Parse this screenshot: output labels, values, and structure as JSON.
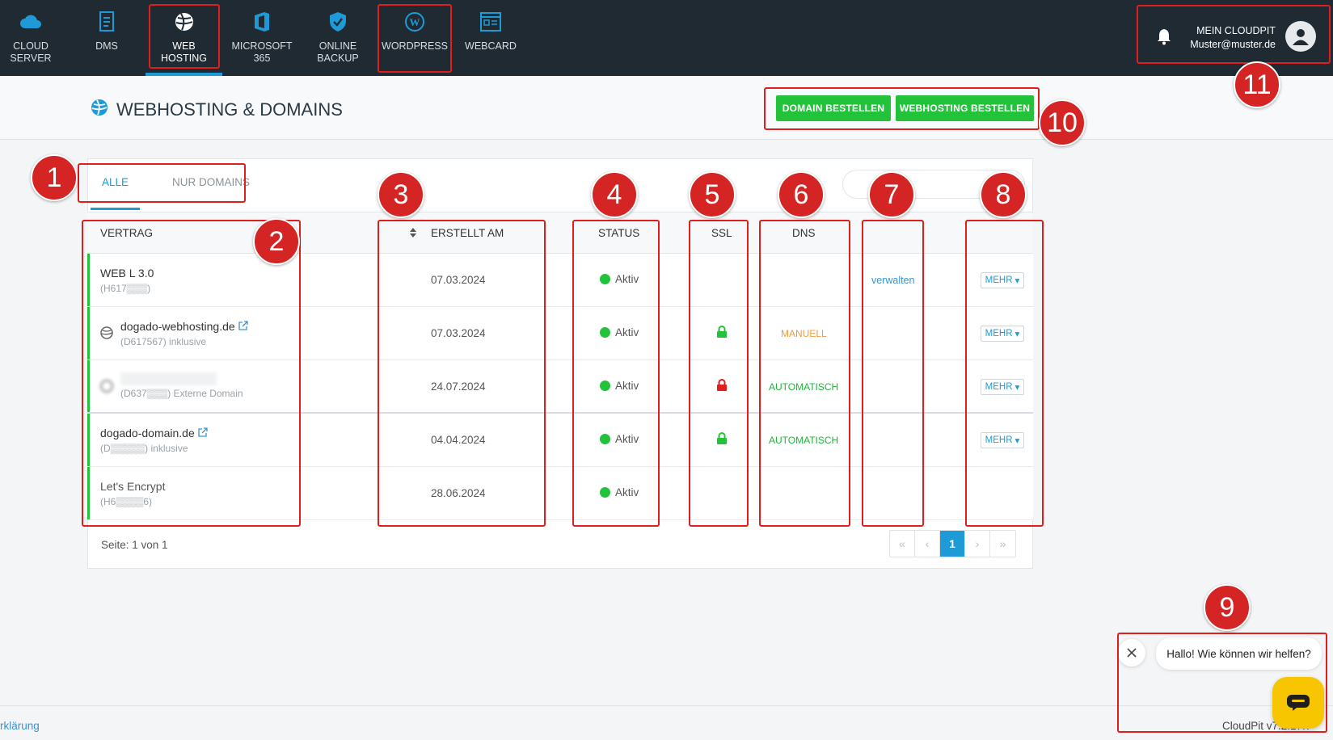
{
  "nav": {
    "items": [
      {
        "label": "CLOUD\nSERVER",
        "icon": "cloud-icon"
      },
      {
        "label": "DMS",
        "icon": "document-icon"
      },
      {
        "label": "WEB\nHOSTING",
        "icon": "globe-icon"
      },
      {
        "label": "MICROSOFT 365",
        "icon": "office-icon"
      },
      {
        "label": "ONLINE\nBACKUP",
        "icon": "shield-icon"
      },
      {
        "label": "WORDPRESS",
        "icon": "wordpress-icon"
      },
      {
        "label": "WEBCARD",
        "icon": "webcard-icon"
      }
    ],
    "account_title": "MEIN CLOUDPIT",
    "account_email": "Muster@muster.de"
  },
  "header": {
    "title": "WEBHOSTING & DOMAINS",
    "btn_domain": "DOMAIN BESTELLEN",
    "btn_webhosting": "WEBHOSTING BESTELLEN"
  },
  "tabs": [
    "ALLE",
    "NUR DOMAINS"
  ],
  "table": {
    "headers": {
      "vertrag": "VERTRAG",
      "erstellt": "ERSTELLT AM",
      "status": "STATUS",
      "ssl": "SSL",
      "dns": "DNS"
    },
    "rows": [
      {
        "name": "WEB L 3.0",
        "sub": "(H617▒▒▒)",
        "date": "07.03.2024",
        "status": "Aktiv",
        "ssl": "",
        "dns": "",
        "action": "verwalten",
        "mehr": "MEHR"
      },
      {
        "name": "dogado-webhosting.de",
        "sub": "(D617567) inklusive",
        "date": "07.03.2024",
        "status": "Aktiv",
        "ssl": "green",
        "dns": "MANUELL",
        "action": "",
        "mehr": "MEHR"
      },
      {
        "name": "▒▒▒▒▒▒▒▒▒▒▒▒",
        "sub": "(D637▒▒▒) Externe Domain",
        "date": "24.07.2024",
        "status": "Aktiv",
        "ssl": "red",
        "dns": "AUTOMATISCH",
        "action": "",
        "mehr": "MEHR"
      },
      {
        "name": "dogado-domain.de",
        "sub": "(D▒▒▒▒▒) inklusive",
        "date": "04.04.2024",
        "status": "Aktiv",
        "ssl": "green",
        "dns": "AUTOMATISCH",
        "action": "",
        "mehr": "MEHR"
      },
      {
        "name": "Let's Encrypt",
        "sub": "(H6▒▒▒▒6)",
        "date": "28.06.2024",
        "status": "Aktiv",
        "ssl": "",
        "dns": "",
        "action": "",
        "mehr": ""
      }
    ]
  },
  "pagination": {
    "text": "Seite: 1 von 1",
    "current": "1"
  },
  "footer": {
    "left": "rklärung",
    "right": "CloudPit v7.2.17.7"
  },
  "chat": {
    "message": "Hallo! Wie können wir helfen?"
  },
  "annotations": [
    "1",
    "2",
    "3",
    "4",
    "5",
    "6",
    "7",
    "8",
    "9",
    "10",
    "11"
  ]
}
